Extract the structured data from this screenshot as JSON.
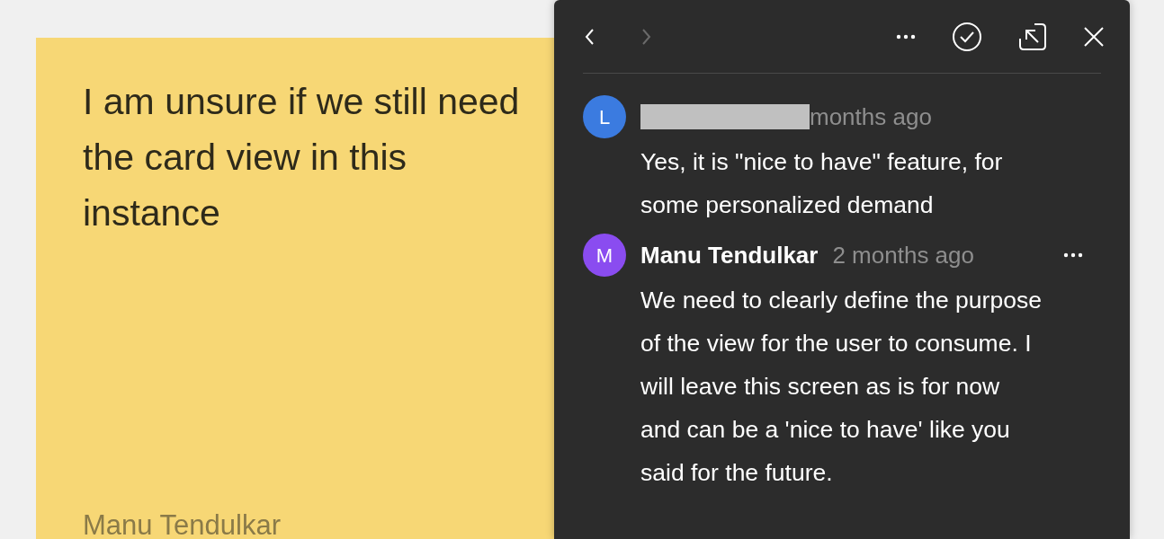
{
  "note": {
    "text": "I am unsure if we still need the card view in this instance",
    "author": "Manu Tendulkar"
  },
  "panel": {
    "nav": [
      {
        "kind": "back",
        "disabled": false
      },
      {
        "kind": "forward",
        "disabled": true
      }
    ],
    "comments": [
      {
        "avatar": "L",
        "color": "#3b7be0",
        "redacted": true,
        "time": "months ago",
        "text": "Yes, it is \"nice to have\" feature, for some personalized demand",
        "has_menu": false
      },
      {
        "avatar": "M",
        "color": "#8a4cf0",
        "redacted": false,
        "author": "Manu Tendulkar",
        "time": "2 months ago",
        "text": "We need to clearly define the purpose of the view for the user to consume. I will leave this screen as is for now and can be a 'nice to have' like you said for the future.",
        "has_menu": true
      }
    ]
  }
}
